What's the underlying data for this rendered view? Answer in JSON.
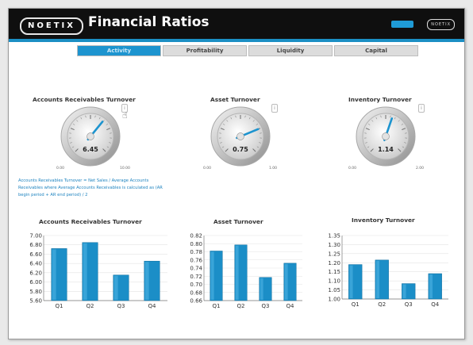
{
  "app": {
    "logo_text": "NOETIX",
    "title": "Financial Ratios",
    "corner_logo_text": "NOETIX"
  },
  "tabs": [
    {
      "label": "Activity",
      "active": true
    },
    {
      "label": "Profitability",
      "active": false
    },
    {
      "label": "Liquidity",
      "active": false
    },
    {
      "label": "Capital",
      "active": false
    }
  ],
  "gauges": [
    {
      "title": "Accounts Receivables Turnover",
      "value": 6.45,
      "value_text": "6.45",
      "min": 0,
      "max": 10,
      "min_label": "0.00",
      "max_label": "10.00"
    },
    {
      "title": "Asset Turnover",
      "value": 0.75,
      "value_text": "0.75",
      "min": 0,
      "max": 1,
      "min_label": "0.00",
      "max_label": "1.00"
    },
    {
      "title": "Inventory Turnover",
      "value": 1.14,
      "value_text": "1.14",
      "min": 0,
      "max": 2,
      "min_label": "0.00",
      "max_label": "2.00"
    }
  ],
  "formula_text": "Accounts Receivables Turnover = Net Sales / Average Accounts Receivables where Average Accounts Receivables is calculated as (AR begin period + AR end period) / 2",
  "info_glyph": "i",
  "cursor_glyph": "☝",
  "colors": {
    "accent": "#1d94cf",
    "bar": "#1b8ec7",
    "topbar": "#0f0f0f"
  },
  "chart_data": [
    {
      "type": "bar",
      "title": "Accounts Receivables Turnover",
      "categories": [
        "Q1",
        "Q2",
        "Q3",
        "Q4"
      ],
      "values": [
        6.72,
        6.85,
        6.15,
        6.45
      ],
      "ylim": [
        5.6,
        7.0
      ],
      "yticks": [
        "7.00",
        "6.80",
        "6.60",
        "6.40",
        "6.20",
        "6.00",
        "5.80",
        "5.60"
      ],
      "ytick_values": [
        7.0,
        6.8,
        6.6,
        6.4,
        6.2,
        6.0,
        5.8,
        5.6
      ]
    },
    {
      "type": "bar",
      "title": "Asset Turnover",
      "categories": [
        "Q1",
        "Q2",
        "Q3",
        "Q4"
      ],
      "values": [
        0.782,
        0.797,
        0.717,
        0.752
      ],
      "ylim": [
        0.66,
        0.82
      ],
      "yticks": [
        "0.82",
        "0.80",
        "0.78",
        "0.76",
        "0.74",
        "0.72",
        "0.70",
        "0.68",
        "0.66"
      ],
      "ytick_values": [
        0.82,
        0.8,
        0.78,
        0.76,
        0.74,
        0.72,
        0.7,
        0.68,
        0.66
      ]
    },
    {
      "type": "bar",
      "title": "Inventory Turnover",
      "categories": [
        "Q1",
        "Q2",
        "Q3",
        "Q4"
      ],
      "values": [
        1.19,
        1.215,
        1.085,
        1.14
      ],
      "ylim": [
        1.0,
        1.35
      ],
      "yticks": [
        "1.35",
        "1.30",
        "1.25",
        "1.20",
        "1.15",
        "1.10",
        "1.05",
        "1.00"
      ],
      "ytick_values": [
        1.35,
        1.3,
        1.25,
        1.2,
        1.15,
        1.1,
        1.05,
        1.0
      ]
    }
  ]
}
